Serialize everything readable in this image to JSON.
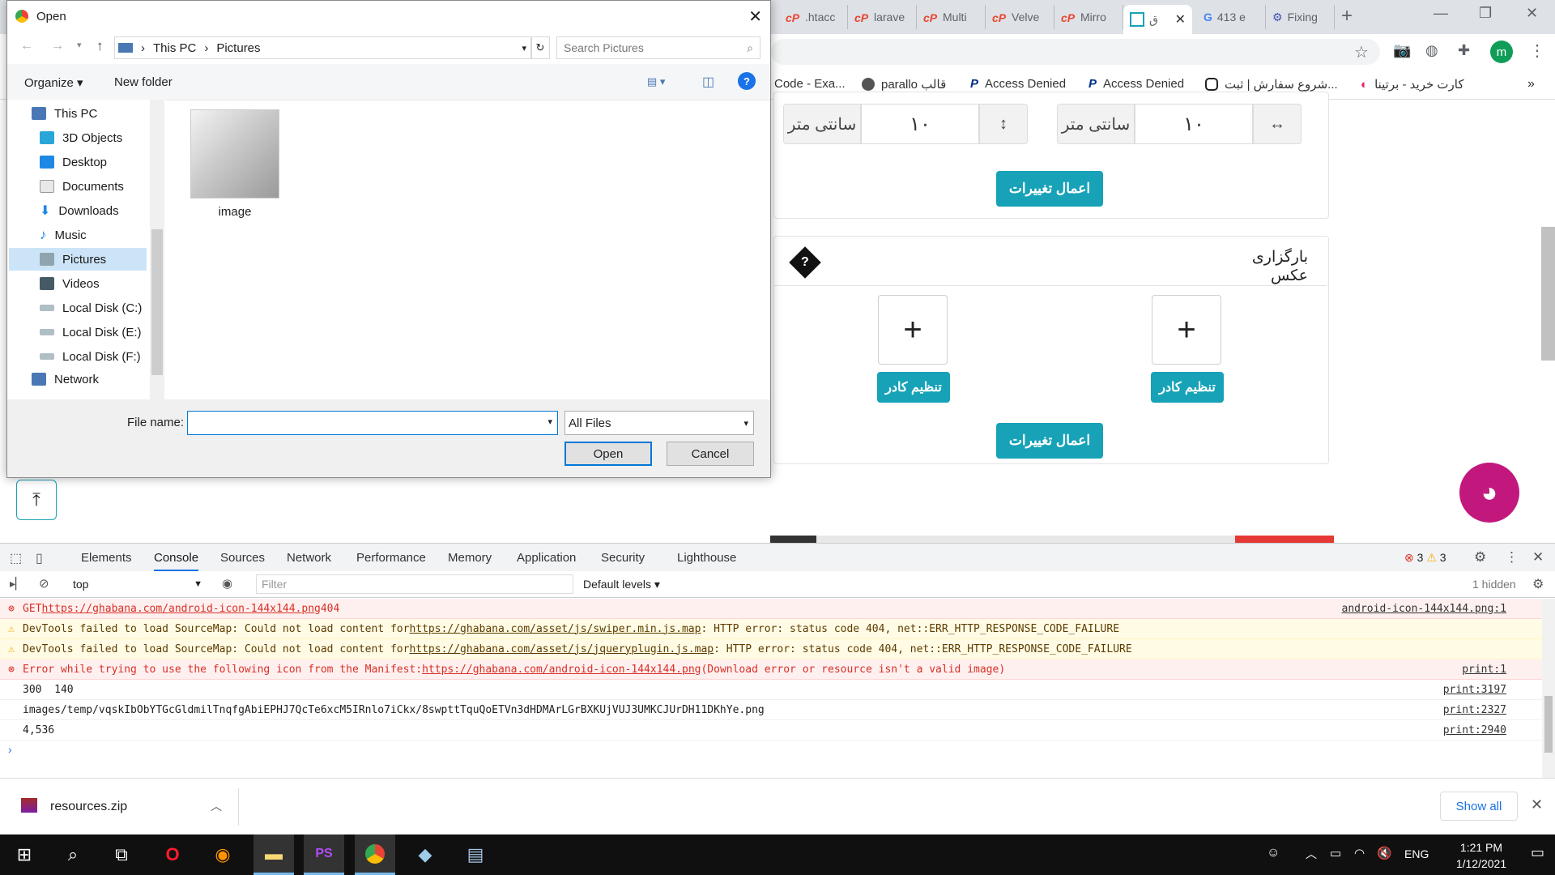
{
  "browser": {
    "tabs": [
      {
        "label": ".htacc"
      },
      {
        "label": "larave"
      },
      {
        "label": "Multi"
      },
      {
        "label": "Velve"
      },
      {
        "label": "Mirro"
      },
      {
        "label": "ق"
      },
      {
        "label": "413 e"
      },
      {
        "label": "Fixing"
      }
    ],
    "profile_initial": "m",
    "bookmarks": [
      {
        "label": "Code - Exa..."
      },
      {
        "label": "parallo قالب"
      },
      {
        "label": "Access Denied"
      },
      {
        "label": "Access Denied"
      },
      {
        "label": "شروع سفارش | ثبت..."
      },
      {
        "label": "کارت خرید - برتینا"
      }
    ]
  },
  "page": {
    "unit_label": "سانتی متر",
    "height_value": "۱۰",
    "width_value": "۱۰",
    "apply_label": "اعمال تغییرات",
    "upload_title": "بارگزاری عکس",
    "help_glyph": "?",
    "plus_glyph": "+",
    "frame_label": "تنظیم کادر",
    "apply_label_2": "اعمال تغییرات"
  },
  "dialog": {
    "title": "Open",
    "breadcrumb": [
      "This PC",
      "Pictures"
    ],
    "search_placeholder": "Search Pictures",
    "organize": "Organize",
    "new_folder": "New folder",
    "tree": [
      {
        "label": "This PC"
      },
      {
        "label": "3D Objects"
      },
      {
        "label": "Desktop"
      },
      {
        "label": "Documents"
      },
      {
        "label": "Downloads"
      },
      {
        "label": "Music"
      },
      {
        "label": "Pictures"
      },
      {
        "label": "Videos"
      },
      {
        "label": "Local Disk (C:)"
      },
      {
        "label": "Local Disk (E:)"
      },
      {
        "label": "Local Disk (F:)"
      },
      {
        "label": "Network"
      }
    ],
    "file": {
      "name": "image"
    },
    "file_name_label": "File name:",
    "file_name_value": "",
    "file_type": "All Files",
    "open_label": "Open",
    "cancel_label": "Cancel"
  },
  "devtools": {
    "tabs": [
      "Elements",
      "Console",
      "Sources",
      "Network",
      "Performance",
      "Memory",
      "Application",
      "Security",
      "Lighthouse"
    ],
    "active_tab": "Console",
    "error_count": "3",
    "warning_count": "3",
    "context": "top",
    "filter_placeholder": "Filter",
    "levels": "Default levels",
    "hidden": "1 hidden",
    "logs": [
      {
        "level": "error",
        "prefix": "GET ",
        "link": "https://ghabana.com/android-icon-144x144.png",
        "suffix": " 404",
        "source": "android-icon-144x144.png:1"
      },
      {
        "level": "warning",
        "prefix": "DevTools failed to load SourceMap: Could not load content for ",
        "link": "https://ghabana.com/asset/js/swiper.min.js.map",
        "suffix": ": HTTP error: status code 404, net::ERR_HTTP_RESPONSE_CODE_FAILURE",
        "source": ""
      },
      {
        "level": "warning",
        "prefix": "DevTools failed to load SourceMap: Could not load content for ",
        "link": "https://ghabana.com/asset/js/jqueryplugin.js.map",
        "suffix": ": HTTP error: status code 404, net::ERR_HTTP_RESPONSE_CODE_FAILURE",
        "source": ""
      },
      {
        "level": "error",
        "prefix": "Error while trying to use the following icon from the Manifest: ",
        "link": "https://ghabana.com/android-icon-144x144.png",
        "suffix": " (Download error or resource isn't a valid image)",
        "source": "print:1"
      },
      {
        "level": "info",
        "prefix": "300  140",
        "link": "",
        "suffix": "",
        "source": "print:3197"
      },
      {
        "level": "info",
        "prefix": "images/temp/vqskIbObYTGcGldmilTnqfgAbiEPHJ7QcTe6xcM5IRnlo7iCkx/8swpttTquQoETVn3dHDMArLGrBXKUjVUJ3UMKCJUrDH11DKhYe.png",
        "link": "",
        "suffix": "",
        "source": "print:2327"
      },
      {
        "level": "info",
        "prefix": "4,536",
        "link": "",
        "suffix": "",
        "source": "print:2940"
      }
    ]
  },
  "downloads": {
    "file": "resources.zip",
    "show_all": "Show all"
  },
  "taskbar": {
    "lang": "ENG",
    "time": "1:21 PM",
    "date": "1/12/2021"
  }
}
